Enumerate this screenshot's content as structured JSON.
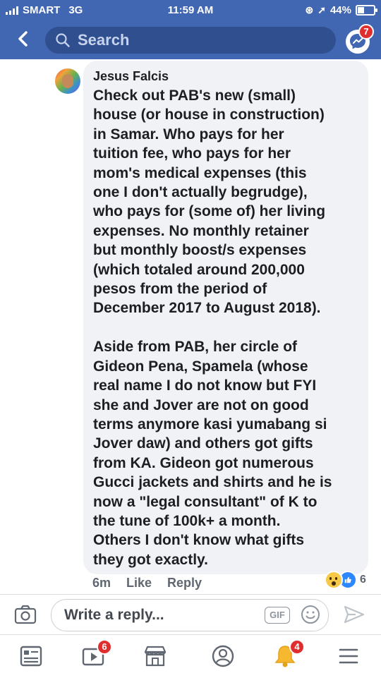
{
  "status": {
    "carrier": "SMART",
    "network": "3G",
    "time": "11:59 AM",
    "battery": "44%",
    "battery_level": 0.44
  },
  "header": {
    "search_placeholder": "Search",
    "messenger_badge": "7"
  },
  "comment": {
    "author": "Jesus Falcis",
    "text": "Check out PAB's new (small)\nhouse (or house in construction)\nin Samar. Who pays for her\ntuition fee, who pays for her\nmom's medical expenses (this\none I don't actually begrudge),\nwho pays for (some of) her living\nexpenses. No monthly retainer\nbut monthly boost/s expenses\n(which totaled around 200,000\npesos from the period of\nDecember 2017 to August 2018).\n\nAside from PAB, her circle of\nGideon Pena, Spamela (whose\nreal name I do not know but FYI\nshe and Jover are not on good\nterms anymore kasi yumabang si\nJover daw) and others got gifts\nfrom KA. Gideon got numerous\nGucci jackets and shirts and he is\nnow a \"legal consultant\" of K to\nthe tune of 100k+ a month.\nOthers I don't know what gifts\nthey got exactly.",
    "time_ago": "6m",
    "like_label": "Like",
    "reply_label": "Reply",
    "reaction_count": "6"
  },
  "reply_bar": {
    "placeholder": "Write a reply...",
    "gif_label": "GIF"
  },
  "tabs": {
    "video_badge": "6",
    "notifications_badge": "4"
  },
  "colors": {
    "brand": "#4267b2",
    "badge": "#e02e2e",
    "like": "#2d88ff"
  }
}
